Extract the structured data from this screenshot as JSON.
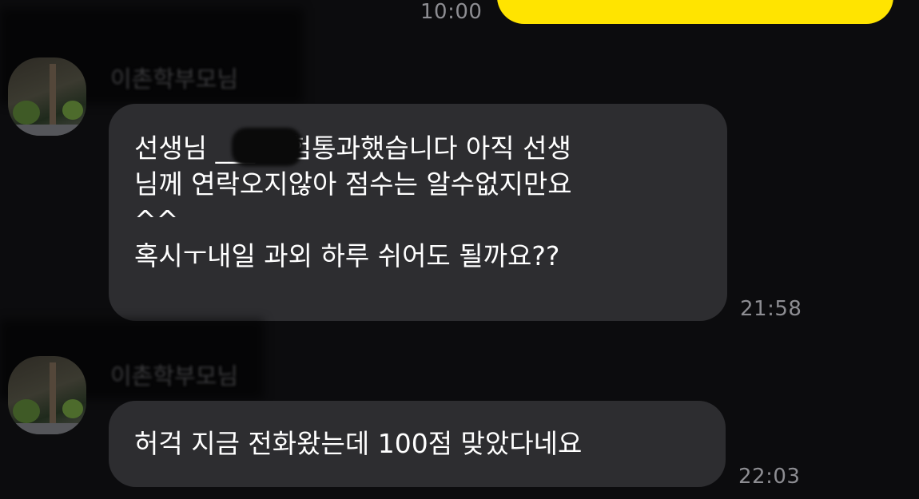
{
  "previous_message": {
    "time": "10:00"
  },
  "messages": [
    {
      "sender": "이촌학부모님",
      "lines": [
        "선생님 ___ 시험통과했습니다 아직 선생",
        "님께 연락오지않아 점수는 알수없지만요",
        "^^",
        "혹시ㅜ내일 과외 하루 쉬어도 될까요??"
      ],
      "time": "21:58"
    },
    {
      "sender": "이촌학부모님",
      "lines": [
        "허걱 지금 전화왔는데 100점 맞았다네요"
      ],
      "time": "22:03"
    }
  ],
  "colors": {
    "background": "#0c0c0e",
    "sent_bubble": "#ffe400",
    "received_bubble": "#2d2d30",
    "timestamp": "#8d8d92"
  }
}
